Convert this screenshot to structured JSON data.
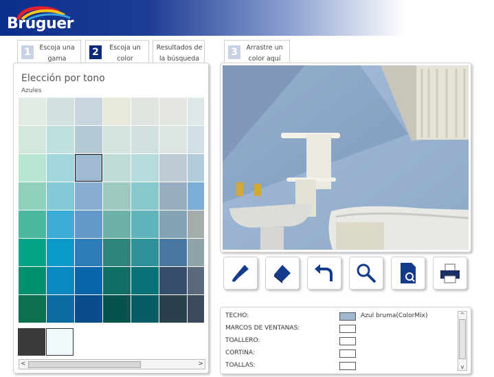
{
  "brand": {
    "name": "Bruguer"
  },
  "steps": [
    {
      "num": "1",
      "line1": "Escoja una",
      "line2": "gama"
    },
    {
      "num": "2",
      "line1": "Escoja un",
      "line2": "color"
    },
    {
      "num": "",
      "line1": "Resultados de",
      "line2": "la búsqueda"
    },
    {
      "num": "3",
      "line1": "Arrastre un",
      "line2": "color aquí"
    }
  ],
  "picker": {
    "title": "Elección por tono",
    "subtitle": "Azules",
    "selected_row": 2,
    "selected_col": 2,
    "swatches": [
      [
        "#e2ebe2",
        "#d5e0e2",
        "#c8d5e0",
        "#e9e8dc",
        "#dfe6e0",
        "#e4e6e2",
        "#dde6e8"
      ],
      [
        "#d2e8dc",
        "#c0e0e0",
        "#b4c9d4",
        "#d4e4dc",
        "#d0e0e0",
        "#dce4e4",
        "#d0dfe6"
      ],
      [
        "#b8e4d2",
        "#a4d5da",
        "#a1bad4",
        "#c0dcd6",
        "#b4dcdc",
        "#bccad4",
        "#b2ccdc"
      ],
      [
        "#8ed0bc",
        "#84c8d8",
        "#88aed2",
        "#9cc8c0",
        "#86c8cc",
        "#98aec0",
        "#7aaed6"
      ],
      [
        "#4cb89e",
        "#3cacd6",
        "#6298ca",
        "#6cb2a6",
        "#62b4bc",
        "#86a2b6",
        "#a4acac"
      ],
      [
        "#02a488",
        "#0a9ac8",
        "#2c7cb8",
        "#2e8478",
        "#2e9098",
        "#4a78a0",
        "#8ea4a8"
      ],
      [
        "#009070",
        "#0a88c0",
        "#0a64a8",
        "#0e7064",
        "#087078",
        "#354e6a",
        "#5a6a7a"
      ],
      [
        "#0a7050",
        "#0a6ca0",
        "#0a4c8c",
        "#04544c",
        "#0a5c64",
        "#2c404c",
        "#3a4a5a"
      ]
    ],
    "chips": [
      "#3a3a3a",
      "#f0fafc"
    ],
    "scroll": {
      "left": "<",
      "right": ">"
    }
  },
  "tools": [
    {
      "icon": "paint-brush-icon"
    },
    {
      "icon": "eraser-icon"
    },
    {
      "icon": "undo-icon"
    },
    {
      "icon": "zoom-icon"
    },
    {
      "icon": "document-search-icon"
    },
    {
      "icon": "print-icon"
    }
  ],
  "surfaces": [
    {
      "label": "TECHO:",
      "swatch": "#9fb8d2",
      "color_name": "Azul bruma(ColorMix)"
    },
    {
      "label": "MARCOS DE VENTANAS:",
      "swatch": "#ffffff",
      "color_name": ""
    },
    {
      "label": "TOALLERO:",
      "swatch": "#ffffff",
      "color_name": ""
    },
    {
      "label": "CORTINA:",
      "swatch": "#ffffff",
      "color_name": ""
    },
    {
      "label": "TOALLAS:",
      "swatch": "#ffffff",
      "color_name": ""
    }
  ],
  "list_scroll": {
    "up": "^",
    "down": "v"
  }
}
